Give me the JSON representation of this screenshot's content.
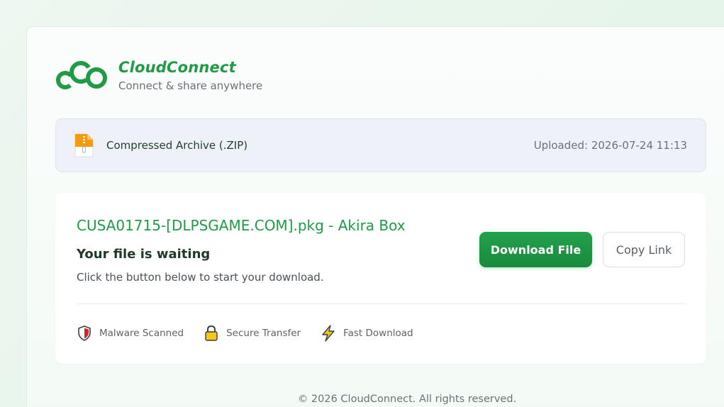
{
  "brand": {
    "name": "CloudConnect",
    "tagline": "Connect & share anywhere",
    "logo_icon": "cco-logo-icon",
    "accent_color": "#1f9a45"
  },
  "file_bar": {
    "icon": "zip-file-icon",
    "type_label": "Compressed Archive (.ZIP)",
    "uploaded": "Uploaded: 2026-07-24 11:13"
  },
  "download": {
    "file_name": "CUSA01715-[DLPSGAME.COM].pkg - Akira Box",
    "status_title": "Your file is waiting",
    "hint": "Click the button below to start your download.",
    "download_label": "Download File",
    "copy_label": "Copy Link"
  },
  "features": [
    {
      "icon": "shield-icon",
      "label": "Malware Scanned"
    },
    {
      "icon": "lock-icon",
      "label": "Secure Transfer"
    },
    {
      "icon": "lightning-icon",
      "label": "Fast Download"
    }
  ],
  "footer": {
    "copyright": "© 2026 CloudConnect. All rights reserved."
  }
}
